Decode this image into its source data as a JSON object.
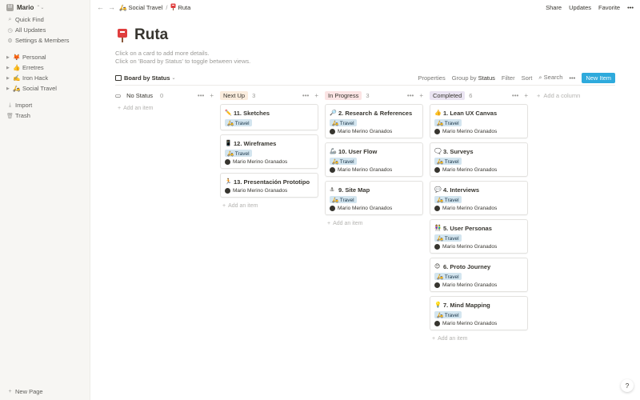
{
  "sidebar": {
    "workspace": {
      "initial": "M",
      "name": "Mario"
    },
    "nav": [
      {
        "icon": "search-icon",
        "glyph": "⌕",
        "label": "Quick Find"
      },
      {
        "icon": "clock-icon",
        "glyph": "◷",
        "label": "All Updates"
      },
      {
        "icon": "gear-icon",
        "glyph": "⚙",
        "label": "Settings & Members"
      }
    ],
    "pages": [
      {
        "emoji": "🦊",
        "label": "Personal"
      },
      {
        "emoji": "👍",
        "label": "Erretres"
      },
      {
        "emoji": "✍️",
        "label": "Iron Hack"
      },
      {
        "emoji": "🛵",
        "label": "Social Travel"
      }
    ],
    "bottom": [
      {
        "icon": "download-icon",
        "glyph": "⤓",
        "label": "Import"
      },
      {
        "icon": "trash-icon",
        "glyph": "🗑",
        "label": "Trash"
      }
    ],
    "new_page": "New Page"
  },
  "topbar": {
    "crumb_parent_emoji": "🛵",
    "crumb_parent": "Social Travel",
    "crumb_current": "Ruta",
    "share": "Share",
    "updates": "Updates",
    "favorite": "Favorite",
    "more": "•••"
  },
  "page": {
    "title": "Ruta",
    "desc_line1": "Click on a card to add more details.",
    "desc_line2": "Click on 'Board by Status' to toggle between views."
  },
  "toolbar": {
    "view": "Board by Status",
    "properties": "Properties",
    "group_by": "Group by",
    "group_by_value": "Status",
    "filter": "Filter",
    "sort": "Sort",
    "search": "Search",
    "more": "•••",
    "new_item": "New Item"
  },
  "board": {
    "add_item": "Add an item",
    "add_column": "Add a column",
    "columns": [
      {
        "name": "No Status",
        "count": "0",
        "color": "",
        "cards": []
      },
      {
        "name": "Next Up",
        "count": "3",
        "color": "#fbecdd",
        "cards": [
          {
            "emoji": "✏️",
            "title": "11. Sketches",
            "tag": "🛵 Travel",
            "person": ""
          },
          {
            "emoji": "📱",
            "title": "12. Wireframes",
            "tag": "🛵 Travel",
            "person": "Mario Merino Granados"
          },
          {
            "emoji": "🏃",
            "title": "13. Presentación Prototipo",
            "tag": "",
            "person": "Mario Merino Granados"
          }
        ]
      },
      {
        "name": "In Progress",
        "count": "3",
        "color": "#fbe4e4",
        "cards": [
          {
            "emoji": "🔎",
            "title": "2. Research & References",
            "tag": "🛵 Travel",
            "person": "Mario Merino Granados"
          },
          {
            "emoji": "🦾",
            "title": "10. User Flow",
            "tag": "🛵 Travel",
            "person": "Mario Merino Granados"
          },
          {
            "emoji": "⚓",
            "title": "9. Site Map",
            "tag": "🛵 Travel",
            "person": "Mario Merino Granados"
          }
        ]
      },
      {
        "name": "Completed",
        "count": "6",
        "color": "#eae4f2",
        "cards": [
          {
            "emoji": "👍",
            "title": "1. Lean UX Canvas",
            "tag": "🛵 Travel",
            "person": "Mario Merino Granados"
          },
          {
            "emoji": "🗨️",
            "title": "3. Surveys",
            "tag": "🛵 Travel",
            "person": "Mario Merino Granados"
          },
          {
            "emoji": "💬",
            "title": "4. Interviews",
            "tag": "🛵 Travel",
            "person": "Mario Merino Granados"
          },
          {
            "emoji": "👫",
            "title": "5. User Personas",
            "tag": "🛵 Travel",
            "person": "Mario Merino Granados"
          },
          {
            "emoji": "😊",
            "title": "6. Proto Journey",
            "tag": "🛵 Travel",
            "person": "Mario Merino Granados"
          },
          {
            "emoji": "💡",
            "title": "7. Mind Mapping",
            "tag": "🛵 Travel",
            "person": "Mario Merino Granados"
          }
        ]
      }
    ]
  },
  "help": "?"
}
